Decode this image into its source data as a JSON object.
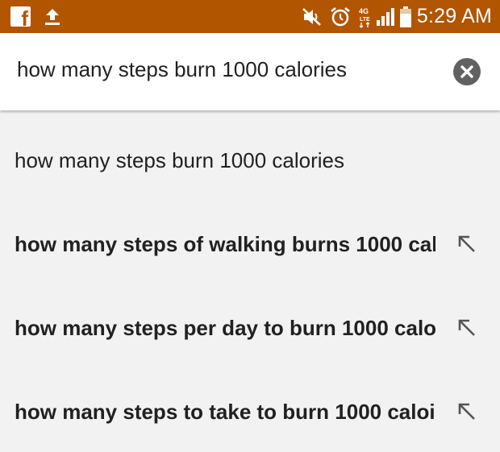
{
  "status_bar": {
    "time": "5:29 AM",
    "network_label": "4G",
    "colors": {
      "background": "#b15500",
      "foreground": "#ffffff"
    },
    "icons": [
      "facebook-icon",
      "upload-icon",
      "mute-icon",
      "alarm-icon",
      "network-4g-icon",
      "signal-icon",
      "battery-icon"
    ]
  },
  "search": {
    "query": "how many steps burn 1000 calories",
    "clear_icon": "close-icon"
  },
  "suggestions": [
    {
      "text": "how many steps burn 1000 calories",
      "bold": false,
      "icon": null
    },
    {
      "text": "how many steps of walking burns 1000 cal",
      "bold": true,
      "icon": "arrow-up-left-icon"
    },
    {
      "text": "how many steps per day to burn 1000 calo",
      "bold": true,
      "icon": "arrow-up-left-icon"
    },
    {
      "text": "how many steps to take to burn 1000 caloi",
      "bold": true,
      "icon": "arrow-up-left-icon"
    }
  ]
}
